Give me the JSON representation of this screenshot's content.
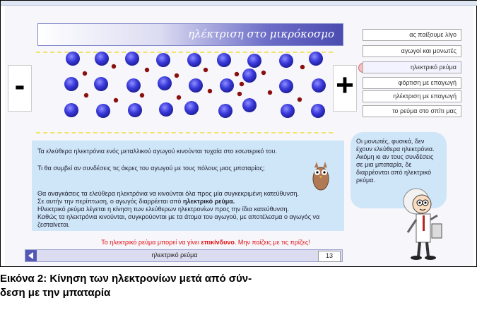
{
  "header": {
    "title": "ηλέκτριση στο μικρόκοσμο"
  },
  "sim": {
    "minus": "-",
    "plus": "+"
  },
  "nav": [
    {
      "label": "ας παίξουμε λίγο"
    },
    {
      "label": "αγωγοί και μονωτές"
    },
    {
      "label": "ηλεκτρικό ρεύμα"
    },
    {
      "label": "φόρτιση με επαγωγή"
    },
    {
      "label": "ηλέκτριση με επαγωγή"
    },
    {
      "label": "το ρεύμα στο σπίτι μας"
    }
  ],
  "info": {
    "p1": "Τα ελεύθερα ηλεκτρόνια ενός μεταλλικού αγωγού κινούνται τυχαία στο εσωτερικό του.",
    "p2": "Τι θα συμβεί αν συνδέσεις τις άκρες του αγωγού με τους πόλους μιας μπαταρίας;",
    "p3a": "Θα αναγκάσεις τα ελεύθερα ηλεκτρόνια να κινούνται όλα προς μία συγκεκριμένη κατεύθυνση.",
    "p3b_pre": "Σε αυτήν την περίπτωση, ο αγωγός διαρρέεται από",
    "p3b_bold": "ηλεκτρικό ρεύμα.",
    "p3c": "Ηλεκτρικό ρεύμα λέγεται η κίνηση των ελεύθερων ηλεκτρονίων προς την ίδια κατεύθυνση.",
    "p3d": "Καθώς τα ηλεκτρόνια κινούνται, συγκρούονται με τα άτομα του αγωγού, με αποτέλεσμα ο αγωγός να",
    "p3e": "ζεσταίνεται."
  },
  "bubble": {
    "text": "Οι μονωτές, φυσικά, δεν έχουν ελεύθερα ηλεκτρόνια. Ακόμη κι αν τους συνδέσεις σε μια μπαταρία, δε διαρρέονται από ηλεκτρικό ρεύμα."
  },
  "warning": {
    "pre": "Το ηλεκτρικό ρεύμα μπορεί να γίνει",
    "bold": "επικίνδυνο",
    "post": ". Μην παίζεις με τις πρίζες!"
  },
  "footer": {
    "label": "ηλεκτρικό ρεύμα",
    "page": "13"
  },
  "caption": {
    "line1": "Εικόνα 2: Κίνηση των ηλεκτρονίων μετά από σύν-",
    "line2": "δεση με την μπαταρία"
  },
  "colors": {
    "atom": "#3434d8",
    "electron": "#8a1010",
    "accent": "#5557b5"
  }
}
